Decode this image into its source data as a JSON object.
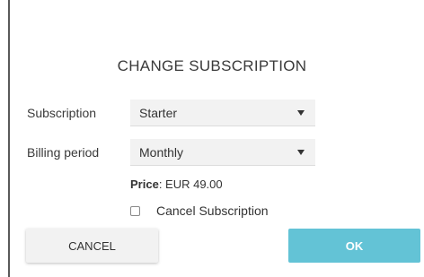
{
  "dialog": {
    "title": "CHANGE SUBSCRIPTION"
  },
  "fields": {
    "subscription": {
      "label": "Subscription",
      "value": "Starter"
    },
    "billing_period": {
      "label": "Billing period",
      "value": "Monthly"
    }
  },
  "price": {
    "label": "Price",
    "value": ": EUR 49.00"
  },
  "cancel_subscription": {
    "label": "Cancel Subscription",
    "checked": false
  },
  "buttons": {
    "cancel": "CANCEL",
    "ok": "OK"
  },
  "colors": {
    "ok_button": "#63c3d6",
    "select_background": "#f2f2f2"
  }
}
